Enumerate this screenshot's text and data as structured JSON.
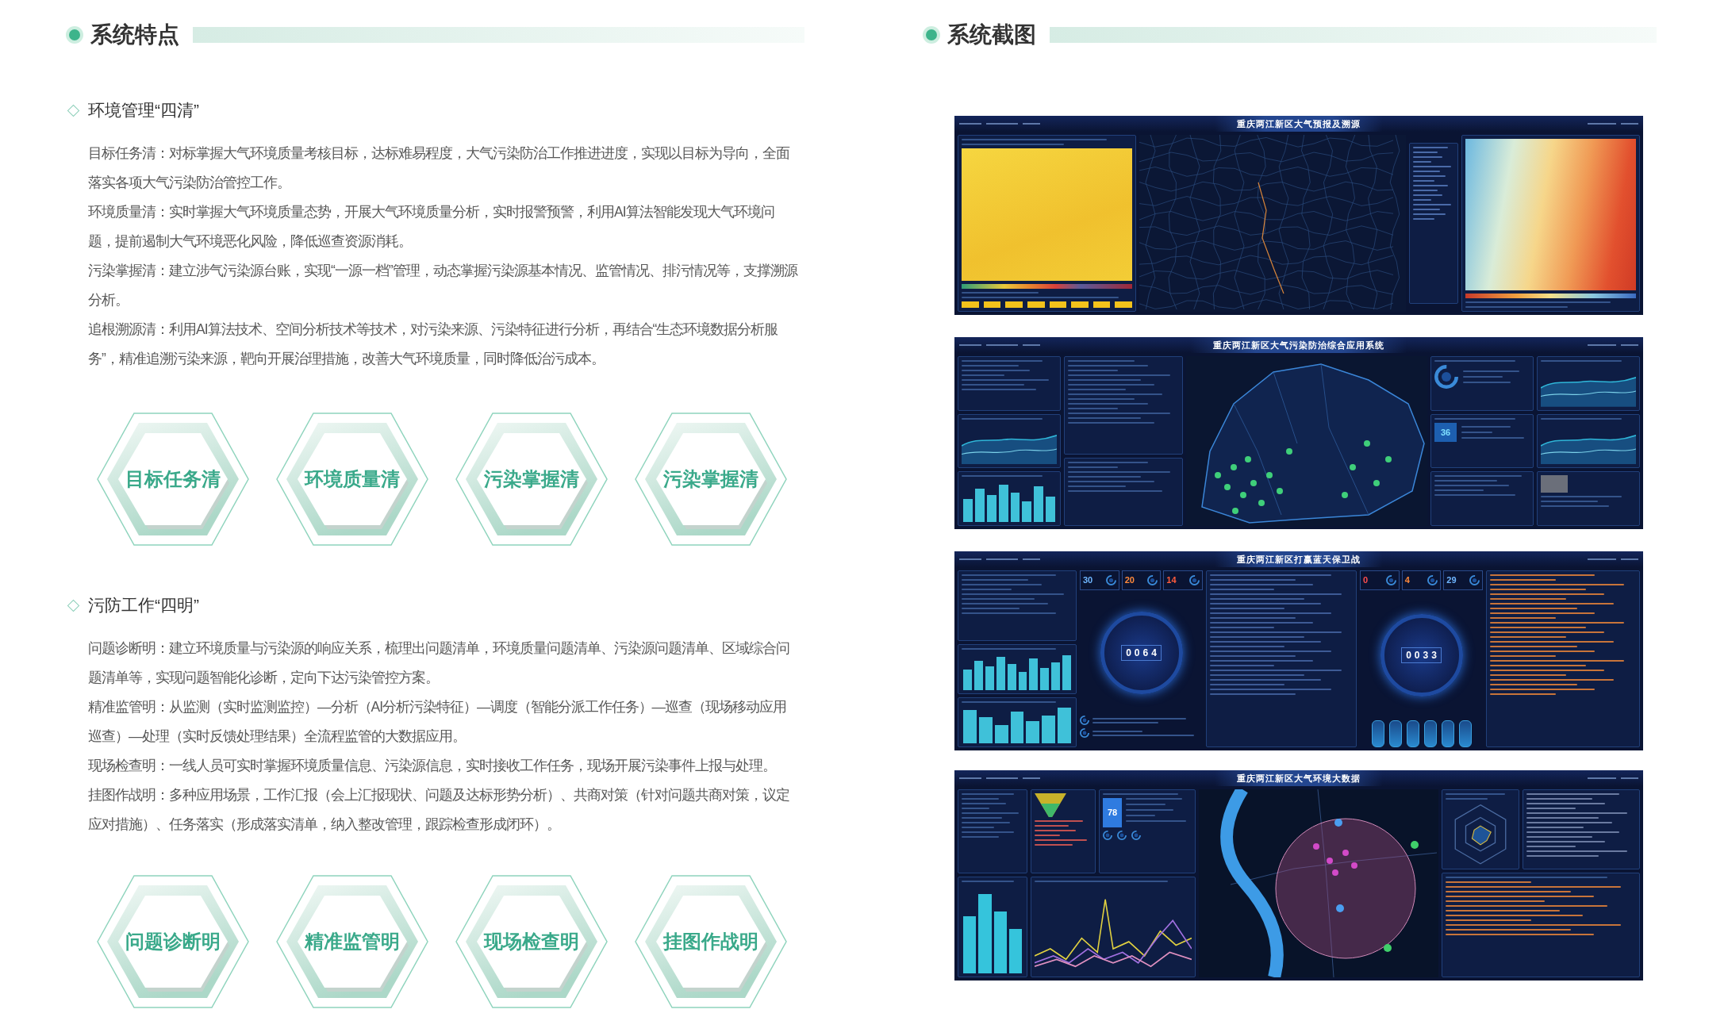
{
  "system_features": {
    "title": "系统特点",
    "groups": [
      {
        "heading": "环境管理“四清”",
        "paragraphs": [
          "目标任务清：对标掌握大气环境质量考核目标，达标难易程度，大气污染防治工作推进进度，实现以目标为导向，全面落实各项大气污染防治管控工作。",
          "环境质量清：实时掌握大气环境质量态势，开展大气环境质量分析，实时报警预警，利用AI算法智能发现大气环境问题，提前遏制大气环境恶化风险，降低巡查资源消耗。",
          "污染掌握清：建立涉气污染源台账，实现“一源一档”管理，动态掌握污染源基本情况、监管情况、排污情况等，支撑溯源分析。",
          "追根溯源清：利用AI算法技术、空间分析技术等技术，对污染来源、污染特征进行分析，再结合“生态环境数据分析服务”，精准追溯污染来源，靶向开展治理措施，改善大气环境质量，同时降低治污成本。"
        ],
        "badges": [
          "目标任务清",
          "环境质量清",
          "污染掌握清",
          "污染掌握清"
        ]
      },
      {
        "heading": "污防工作“四明”",
        "paragraphs": [
          "问题诊断明：建立环境质量与污染源的响应关系，梳理出问题清单，环境质量问题清单、污染源问题清单、区域综合问题清单等，实现问题智能化诊断，定向下达污染管控方案。",
          "精准监管明：从监测（实时监测监控）—分析（AI分析污染特征）—调度（智能分派工作任务）—巡查（现场移动应用巡查）—处理（实时反馈处理结果）全流程监管的大数据应用。",
          "现场检查明：一线人员可实时掌握环境质量信息、污染源信息，实时接收工作任务，现场开展污染事件上报与处理。",
          "挂图作战明：多种应用场景，工作汇报（会上汇报现状、问题及达标形势分析）、共商对策（针对问题共商对策，议定应对措施）、任务落实（形成落实清单，纳入整改管理，跟踪检查形成闭环）。"
        ],
        "badges": [
          "问题诊断明",
          "精准监管明",
          "现场检查明",
          "挂图作战明"
        ]
      }
    ]
  },
  "system_screenshots": {
    "title": "系统截图",
    "screenshots": [
      {
        "kind": "forecast",
        "title": "重庆两江新区大气预报及溯源"
      },
      {
        "kind": "integrated",
        "title": "重庆两江新区大气污染防治综合应用系统",
        "highlight_value": "36"
      },
      {
        "kind": "bluesky",
        "title": "重庆两江新区打赢蓝天保卫战",
        "dials": [
          {
            "stats": [
              {
                "value": "30",
                "color": "#6fb6ff"
              },
              {
                "value": "20",
                "color": "#ff8a3c"
              },
              {
                "value": "14",
                "color": "#ff5c3c"
              }
            ],
            "counter": "0064"
          },
          {
            "stats": [
              {
                "value": "0",
                "color": "#ff4d4d"
              },
              {
                "value": "4",
                "color": "#ff8a3c"
              },
              {
                "value": "29",
                "color": "#6fb6ff"
              }
            ],
            "counter": "0033"
          }
        ]
      },
      {
        "kind": "bigdata",
        "title": "重庆两江新区大气环境大数据",
        "highlight_value": "78"
      }
    ]
  }
}
